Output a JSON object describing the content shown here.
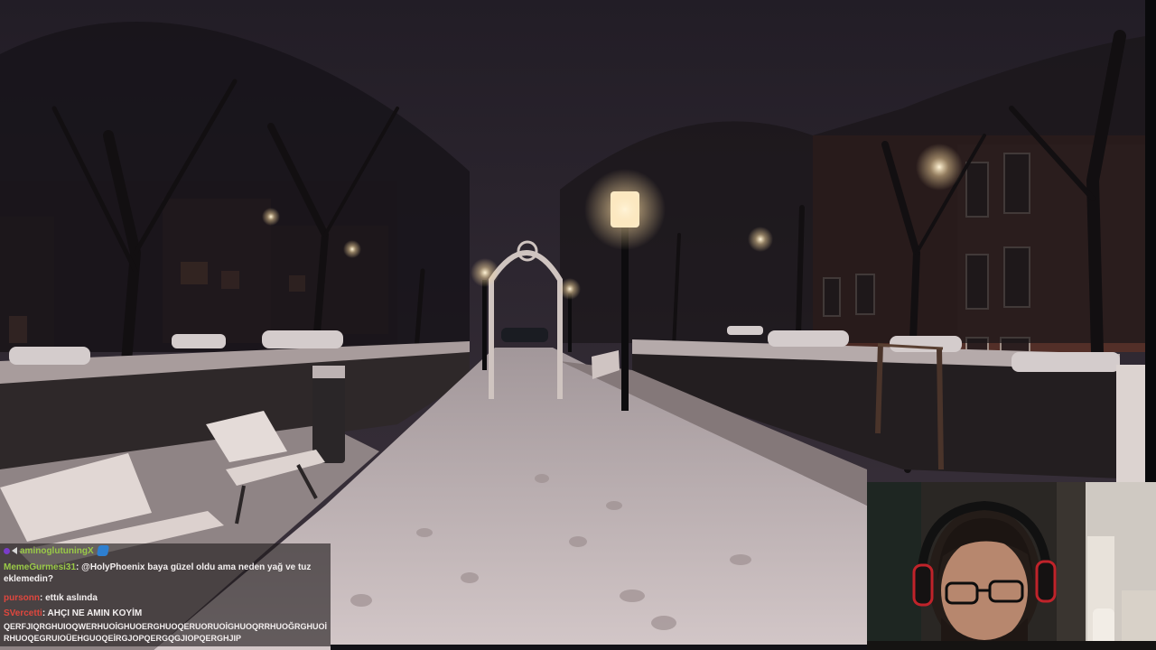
{
  "chat": {
    "lines": [
      {
        "user": "aminoglutuningX",
        "color": "#9aca47",
        "message": ""
      },
      {
        "user": "MemeGurmesi31",
        "color": "#9aca47",
        "message": ": @HolyPhoenix baya güzel oldu ama neden yağ ve tuz eklemedin?"
      },
      {
        "user": "pursonn",
        "color": "#e0473e",
        "message": ": ettık aslında"
      },
      {
        "user": "SVercetti",
        "color": "#e0473e",
        "message": ": AHÇI NE AMIN KOYİM"
      },
      {
        "user": "",
        "color": "#ffffff",
        "message": "QERFJIQRGHUIOQWERHUOİGHUOERGHUOQERUORUOİGHUOQRRHUOĞRGHUOİRHUOQEGRUIOÜEHGUOQEİRGJOPQERGQGJIOPQERGHJIP"
      }
    ]
  },
  "webcam": {
    "label": "streamer-webcam"
  },
  "colors": {
    "sky": "#2e2731",
    "snow": "#c9bcbd",
    "chat_bg": "#1e1a1c"
  }
}
